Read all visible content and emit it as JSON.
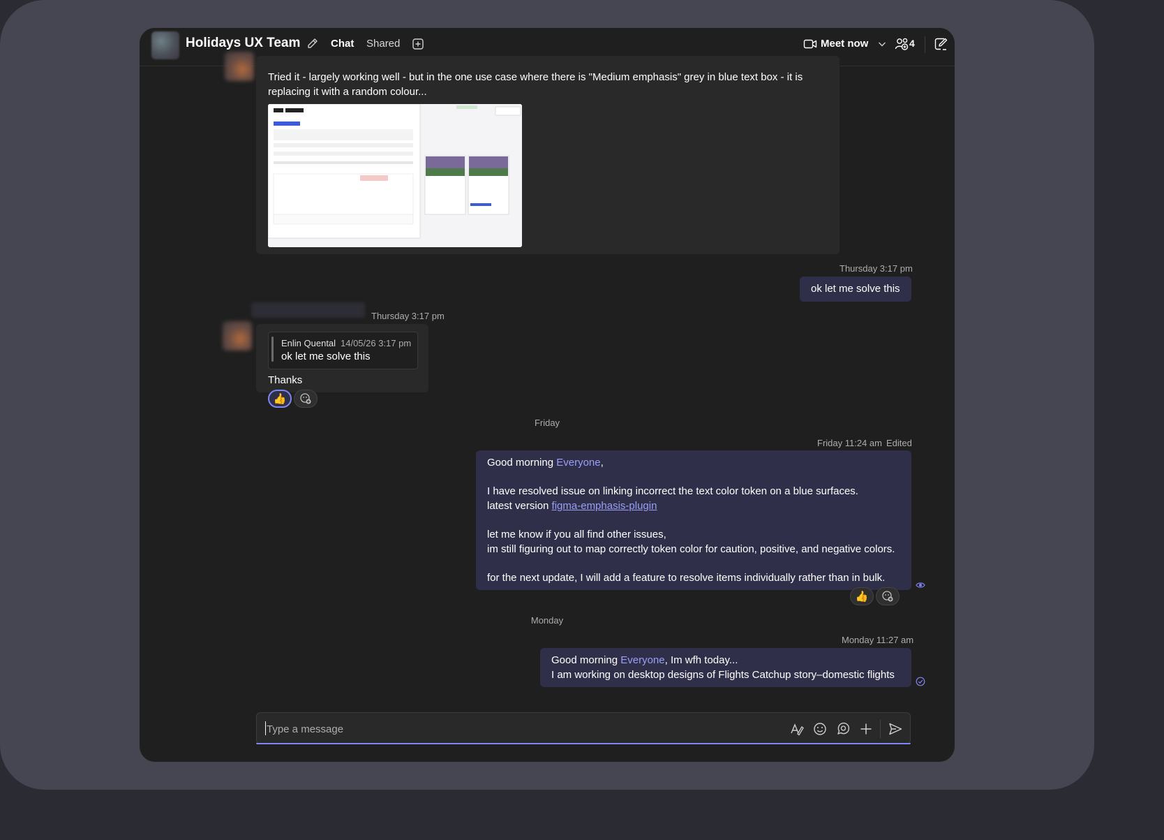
{
  "header": {
    "title": "Holidays UX Team",
    "tabs": [
      {
        "label": "Chat",
        "active": true
      },
      {
        "label": "Shared",
        "active": false
      }
    ],
    "meet_label": "Meet now",
    "participant_count": "4"
  },
  "messages": {
    "m1": {
      "line1": "Tried it - largely working well - but in the one use case where there is \"Medium emphasis\" grey in blue text box - it is",
      "line2": "replacing it with a random colour..."
    },
    "m2": {
      "timestamp": "Thursday 3:17 pm",
      "text": "ok let me solve this"
    },
    "m3": {
      "timestamp": "Thursday 3:17 pm",
      "quote_author": "Enlin Quental",
      "quote_time": "14/05/26 3:17 pm",
      "quote_text": "ok let me solve this",
      "text": "Thanks",
      "reaction": "👍"
    },
    "day_friday": "Friday",
    "m4": {
      "timestamp": "Friday 11:24 am",
      "edited": "Edited",
      "greeting_prefix": "Good morning ",
      "mention": "Everyone",
      "greeting_suffix": ",",
      "line2": "I have resolved issue on linking incorrect the text color token on a blue surfaces.",
      "line3_prefix": "latest version ",
      "link": "figma-emphasis-plugin",
      "line4": "let me know if you all find other issues,",
      "line5": "im still figuring out to map correctly token color for caution, positive, and negative colors.",
      "line6": "for the next update, I will add a feature to resolve items individually rather than in bulk.",
      "reaction": "👍"
    },
    "day_monday": "Monday",
    "m5": {
      "timestamp": "Monday 11:27 am",
      "greeting_prefix": "Good morning ",
      "mention": "Everyone",
      "greeting_suffix": ", Im wfh today...",
      "line2": "I am working on desktop designs of Flights Catchup story–domestic flights"
    }
  },
  "composer": {
    "placeholder": "Type a message"
  },
  "colors": {
    "accent": "#7f85f5",
    "mention": "#9a9ff7",
    "own_bubble": "#2f2f4a"
  }
}
